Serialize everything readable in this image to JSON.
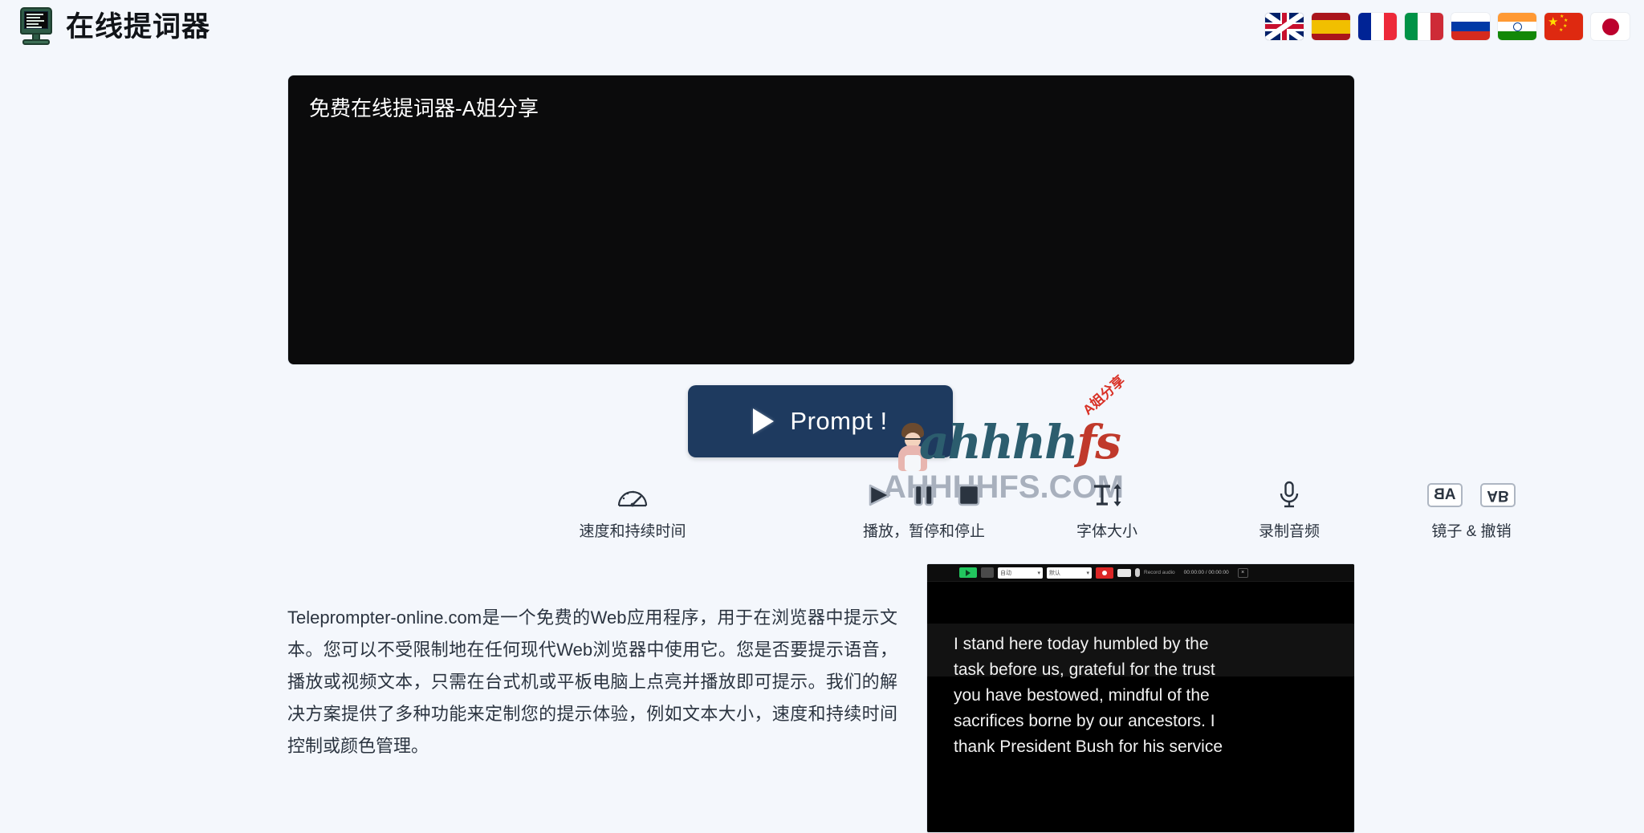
{
  "header": {
    "logo_icon": "monitor-icon",
    "title": "在线提词器",
    "flags": [
      {
        "name": "flag-uk",
        "label": "English"
      },
      {
        "name": "flag-spain",
        "label": "Español"
      },
      {
        "name": "flag-france",
        "label": "Français"
      },
      {
        "name": "flag-italy",
        "label": "Italiano"
      },
      {
        "name": "flag-russia",
        "label": "Русский"
      },
      {
        "name": "flag-india",
        "label": "हिन्दी"
      },
      {
        "name": "flag-china",
        "label": "中文"
      },
      {
        "name": "flag-japan",
        "label": "日本語"
      }
    ]
  },
  "prompt_editor": {
    "value": "免费在线提词器-A姐分享",
    "placeholder": "免费在线提词器-A姐分享",
    "background": "#0b0b0c",
    "text_color": "#ffffff"
  },
  "prompt_button": {
    "label": "Prompt !",
    "icon": "play-icon",
    "background": "#1e3a5f",
    "text_color": "#ffffff"
  },
  "watermark": {
    "logo_part1": "ahhhh",
    "logo_part2": "fs",
    "cn_tag": "A姐分享",
    "domain": "AHHHHFS.COM",
    "logo_color_1": "#2c5d6e",
    "logo_color_2": "#c0392b",
    "cn_tag_color": "#d93025",
    "domain_color": "#8b95a5"
  },
  "toolbar": {
    "groups": [
      {
        "key": "speed",
        "caption": "速度和持续时间",
        "icons": [
          "speedometer-icon"
        ]
      },
      {
        "key": "playback",
        "caption": "播放，暂停和停止",
        "icons": [
          "play-icon",
          "pause-icon",
          "stop-icon"
        ]
      },
      {
        "key": "font_size",
        "caption": "字体大小",
        "icons": [
          "font-size-icon"
        ]
      },
      {
        "key": "record_audio",
        "caption": "录制音频",
        "icons": [
          "microphone-icon"
        ]
      },
      {
        "key": "mirror_undo",
        "caption": "镜子 & 撤销",
        "icons": [
          "mirror-horizontal-icon",
          "mirror-vertical-icon"
        ],
        "mirror_h_text": "AB",
        "mirror_v_text": "AB"
      }
    ]
  },
  "description": {
    "text": "Teleprompter-online.com是一个免费的Web应用程序，用于在浏览器中提示文本。您可以不受限制地在任何现代Web浏览器中使用它。您是否要提示语音，播放或视频文本，只需在台式机或平板电脑上点亮并播放即可提示。我们的解决方案提供了多种功能来定制您的提示体验，例如文本大小，速度和持续时间控制或颜色管理。"
  },
  "video_preview": {
    "toolbar": {
      "play_icon": "play-icon",
      "settings_icon": "settings-icon",
      "select_1": "自动",
      "select_2": "默认",
      "record_icon": "record-icon",
      "camera_icon": "camera-icon",
      "mic_icon": "microphone-icon",
      "status_text": "Record audio",
      "time_text": "00:00:00 / 00:00:00",
      "close_label": "×"
    },
    "lines": [
      "I stand here today humbled by the",
      "task before us, grateful for the trust",
      "you have bestowed, mindful of the",
      "sacrifices borne by our ancestors. I",
      "thank President Bush for his service"
    ]
  }
}
